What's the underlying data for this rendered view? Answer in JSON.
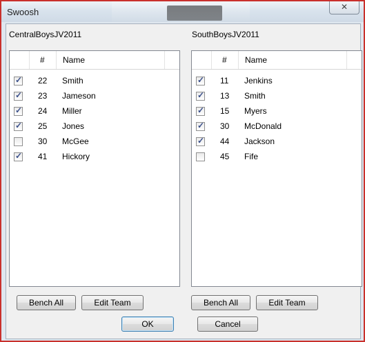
{
  "window": {
    "title": "Swoosh",
    "close_glyph": "✕"
  },
  "left_team": {
    "name": "CentralBoysJV2011",
    "headers": {
      "num": "#",
      "name": "Name"
    },
    "players": [
      {
        "num": "22",
        "name": "Smith",
        "checked": true
      },
      {
        "num": "23",
        "name": "Jameson",
        "checked": true
      },
      {
        "num": "24",
        "name": "Miller",
        "checked": true
      },
      {
        "num": "25",
        "name": "Jones",
        "checked": true
      },
      {
        "num": "30",
        "name": "McGee",
        "checked": false
      },
      {
        "num": "41",
        "name": "Hickory",
        "checked": true
      }
    ],
    "bench_all": "Bench All",
    "edit_team": "Edit Team"
  },
  "right_team": {
    "name": "SouthBoysJV2011",
    "headers": {
      "num": "#",
      "name": "Name"
    },
    "players": [
      {
        "num": "11",
        "name": "Jenkins",
        "checked": true
      },
      {
        "num": "13",
        "name": "Smith",
        "checked": true
      },
      {
        "num": "15",
        "name": "Myers",
        "checked": true
      },
      {
        "num": "30",
        "name": "McDonald",
        "checked": true
      },
      {
        "num": "44",
        "name": "Jackson",
        "checked": true
      },
      {
        "num": "45",
        "name": "Fife",
        "checked": false
      }
    ],
    "bench_all": "Bench All",
    "edit_team": "Edit Team"
  },
  "footer": {
    "ok": "OK",
    "cancel": "Cancel"
  }
}
